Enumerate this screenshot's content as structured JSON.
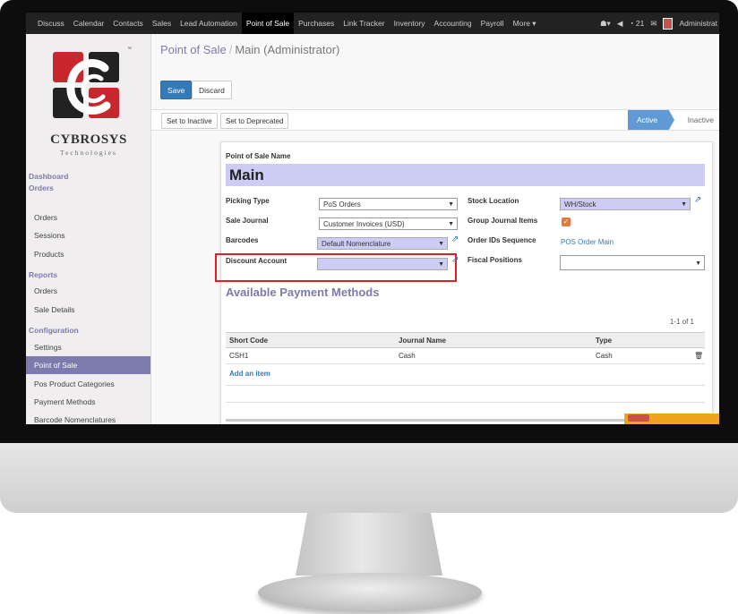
{
  "topbar": {
    "menu": [
      "Discuss",
      "Calendar",
      "Contacts",
      "Sales",
      "Lead Automation",
      "Point of Sale",
      "Purchases",
      "Link Tracker",
      "Inventory",
      "Accounting",
      "Payroll",
      "More ▾"
    ],
    "active_menu": "Point of Sale",
    "messages_count": "21",
    "user": "Administrat"
  },
  "sidebar": {
    "brand": "CYBROSYS",
    "brand_sub": "Technologies",
    "sections": {
      "dashboard": "Dashboard",
      "orders": "Orders",
      "reports": "Reports",
      "configuration": "Configuration"
    },
    "order_items": [
      "Orders",
      "Sessions",
      "Products"
    ],
    "report_items": [
      "Orders",
      "Sale Details"
    ],
    "config_items": [
      "Settings",
      "Point of Sale",
      "Pos Product Categories",
      "Payment Methods",
      "Barcode Nomenclatures"
    ],
    "active_item": "Point of Sale"
  },
  "breadcrumb": {
    "parent": "Point of Sale",
    "separator": "/",
    "current": "Main (Administrator)"
  },
  "buttons": {
    "save": "Save",
    "discard": "Discard",
    "set_inactive": "Set to Inactive",
    "set_deprecated": "Set to Deprecated"
  },
  "stages": {
    "active": "Active",
    "inactive": "Inactive"
  },
  "form": {
    "name_label": "Point of Sale Name",
    "name_value": "Main",
    "picking_type_label": "Picking Type",
    "picking_type_value": "PoS Orders",
    "sale_journal_label": "Sale Journal",
    "sale_journal_value": "Customer Invoices (USD)",
    "barcodes_label": "Barcodes",
    "barcodes_value": "Default Nomenclature",
    "discount_account_label": "Discount Account",
    "discount_account_value": "",
    "stock_location_label": "Stock Location",
    "stock_location_value": "WH/Stock",
    "group_journal_label": "Group Journal Items",
    "group_journal_checked": true,
    "order_ids_label": "Order IDs Sequence",
    "order_ids_value": "POS Order Main",
    "fiscal_positions_label": "Fiscal Positions",
    "fiscal_positions_value": ""
  },
  "payment_methods": {
    "title": "Available Payment Methods",
    "pager": "1-1 of 1",
    "columns": [
      "Short Code",
      "Journal Name",
      "Type"
    ],
    "rows": [
      {
        "code": "CSH1",
        "journal": "Cash",
        "type": "Cash"
      }
    ],
    "add_item": "Add an item"
  },
  "colors": {
    "accent": "#7c7bad",
    "primary": "#337ab7",
    "required": "#ccccf5",
    "highlight": "#e02020"
  }
}
